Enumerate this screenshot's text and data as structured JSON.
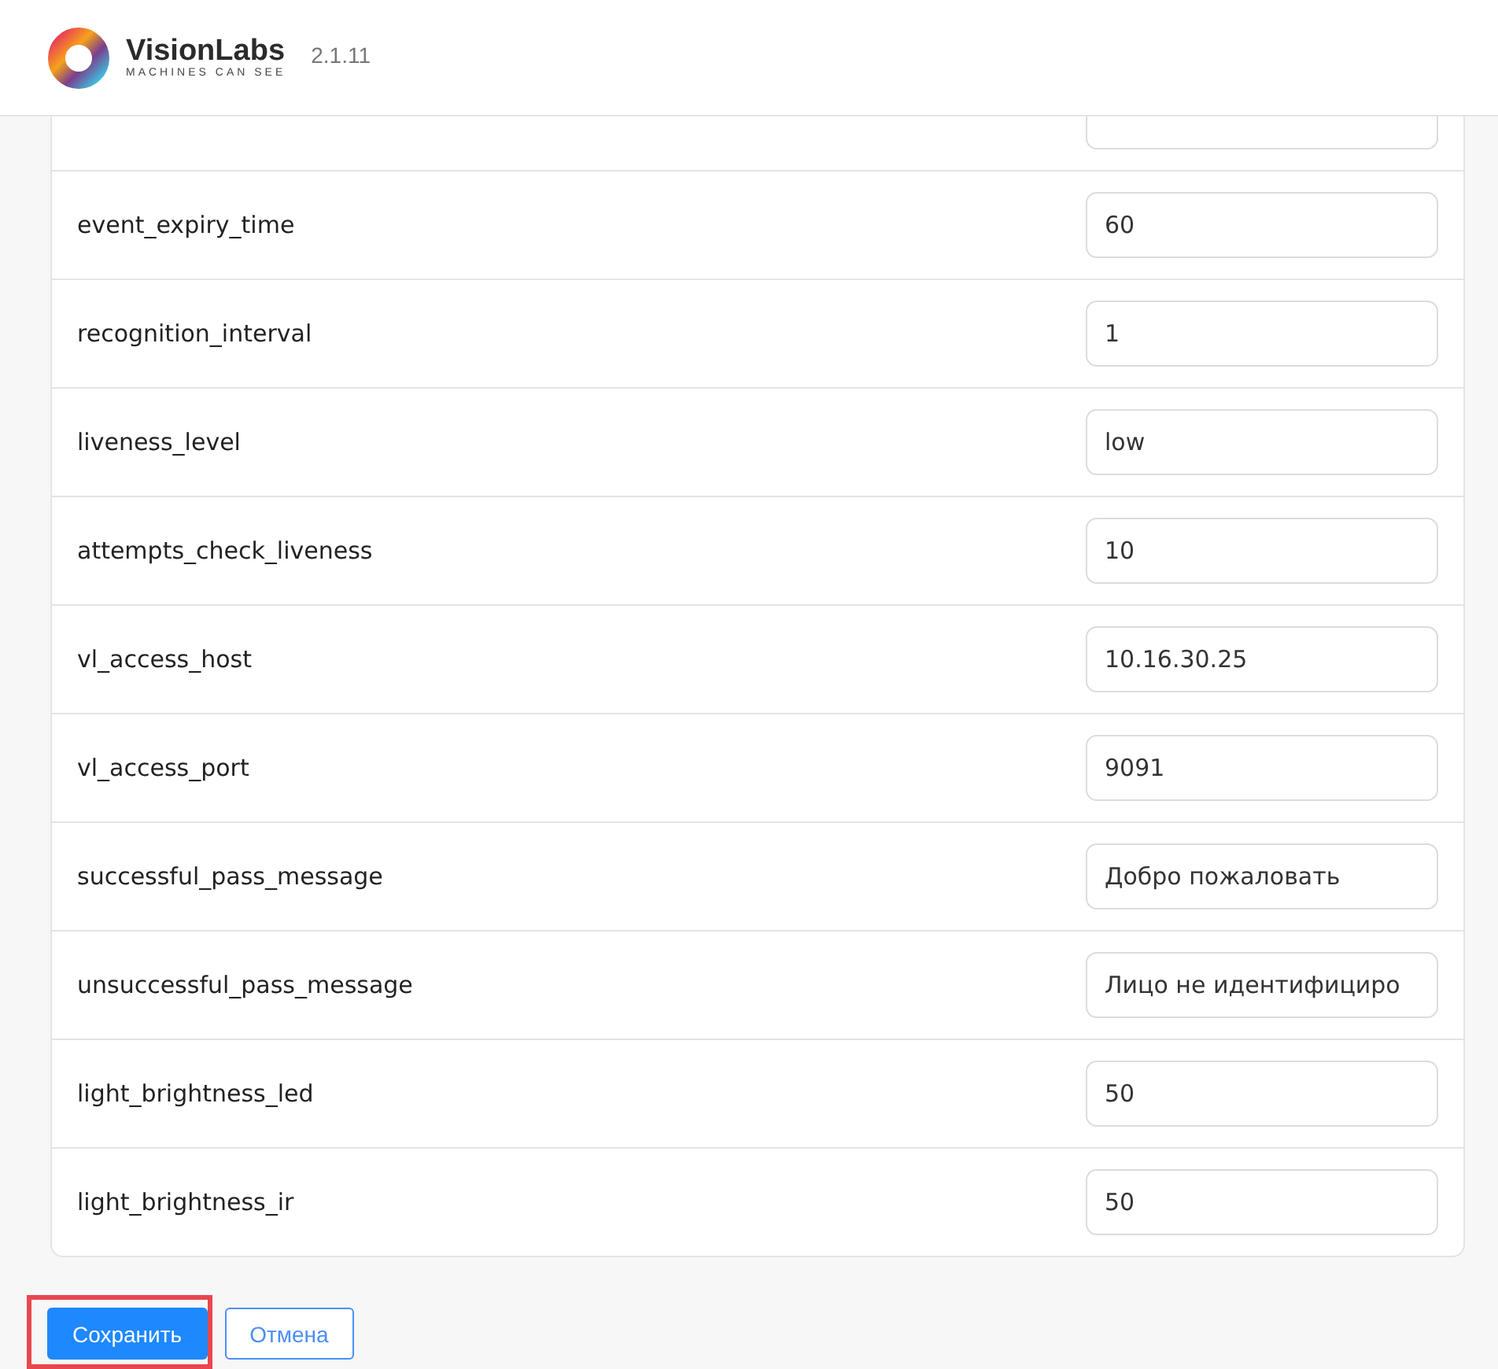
{
  "header": {
    "brand": "VisionLabs",
    "tagline": "MACHINES CAN SEE",
    "version": "2.1.11"
  },
  "settings": [
    {
      "name": "event_expiry_time",
      "value": "60"
    },
    {
      "name": "recognition_interval",
      "value": "1"
    },
    {
      "name": "liveness_level",
      "value": "low"
    },
    {
      "name": "attempts_check_liveness",
      "value": "10"
    },
    {
      "name": "vl_access_host",
      "value": "10.16.30.25"
    },
    {
      "name": "vl_access_port",
      "value": "9091"
    },
    {
      "name": "successful_pass_message",
      "value": "Добро пожаловать"
    },
    {
      "name": "unsuccessful_pass_message",
      "value": "Лицо не идентифициро"
    },
    {
      "name": "light_brightness_led",
      "value": "50"
    },
    {
      "name": "light_brightness_ir",
      "value": "50"
    }
  ],
  "buttons": [
    {
      "label": "Сохранить",
      "kind": "primary",
      "highlighted": true
    },
    {
      "label": "Отмена",
      "kind": "secondary",
      "highlighted": false
    }
  ]
}
